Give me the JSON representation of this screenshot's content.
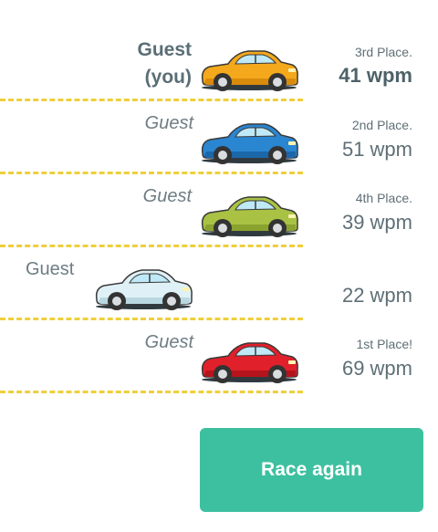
{
  "racers": [
    {
      "name_line1": "Guest",
      "name_line2": "(you)",
      "place": "3rd Place.",
      "wpm": "41 wpm",
      "car_color": "#f4a81b",
      "car_dark": "#d98b0c"
    },
    {
      "name": "Guest",
      "place": "2nd Place.",
      "wpm": "51 wpm",
      "car_color": "#2a86d1",
      "car_dark": "#1b67aa"
    },
    {
      "name": "Guest",
      "place": "4th Place.",
      "wpm": "39 wpm",
      "car_color": "#a9c244",
      "car_dark": "#8aa32f"
    },
    {
      "name": "Guest",
      "place": "",
      "wpm": "22 wpm",
      "car_color": "#dff1f6",
      "car_dark": "#b9d8e2"
    },
    {
      "name": "Guest",
      "place": "1st Place!",
      "wpm": "69 wpm",
      "car_color": "#e0202a",
      "car_dark": "#b5141d"
    }
  ],
  "race_again_label": "Race again",
  "colors": {
    "accent": "#3dc0a0",
    "lane_divider": "#efcf3c",
    "text": "#5e6f76"
  }
}
